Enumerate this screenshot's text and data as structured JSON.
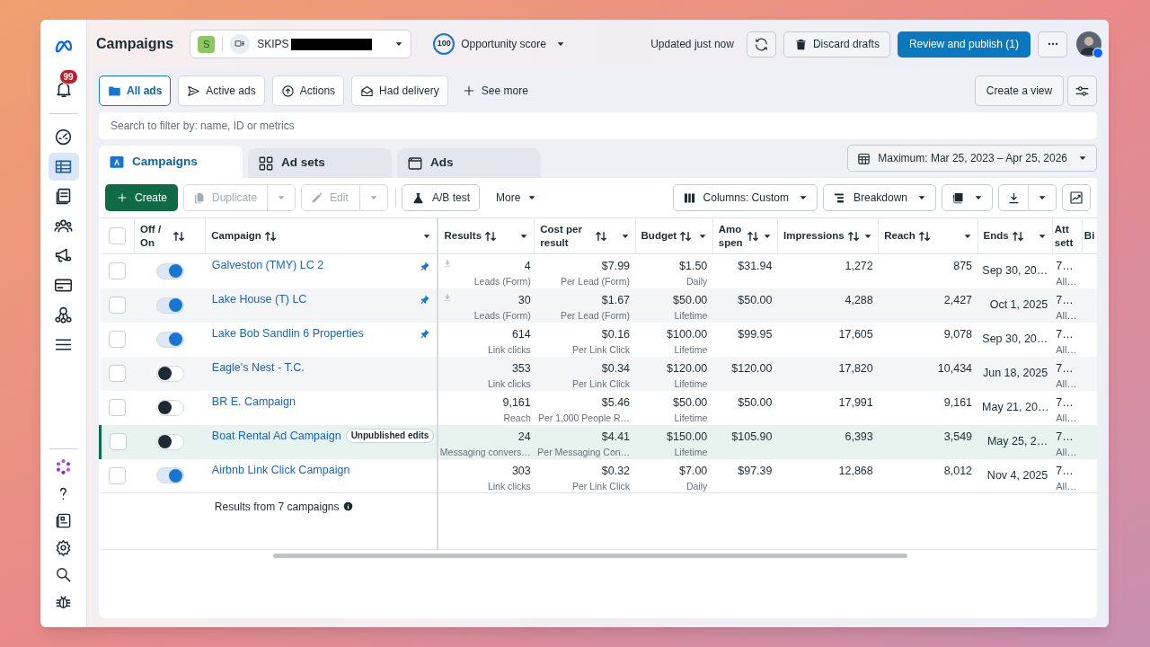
{
  "window": {
    "title": "Campaigns"
  },
  "account": {
    "initial": "S",
    "name": "SKIPS",
    "redacted": true
  },
  "opportunity": {
    "score": "100",
    "label": "Opportunity score"
  },
  "status": "Updated just now",
  "header_buttons": [
    {
      "kind": "refresh"
    },
    {
      "kind": "discard",
      "label": "Discard drafts"
    },
    {
      "kind": "publish",
      "label": "Review and publish (1)"
    },
    {
      "kind": "more"
    }
  ],
  "sidebar": {
    "notifications": "99",
    "top_items": [
      {
        "kind": "gauge",
        "selected": false
      },
      {
        "kind": "table",
        "selected": true
      },
      {
        "kind": "pages",
        "selected": false
      },
      {
        "kind": "people",
        "selected": false
      },
      {
        "kind": "megaphone",
        "selected": false
      },
      {
        "kind": "card",
        "selected": false
      },
      {
        "kind": "network",
        "selected": false
      },
      {
        "kind": "menu",
        "selected": false
      }
    ],
    "bottom_items": [
      {
        "kind": "flower"
      },
      {
        "kind": "help"
      },
      {
        "kind": "news"
      },
      {
        "kind": "settings"
      },
      {
        "kind": "search"
      },
      {
        "kind": "bug"
      }
    ]
  },
  "filters": [
    {
      "kind": "folder",
      "label": "All ads",
      "selected": true
    },
    {
      "kind": "send",
      "label": "Active ads",
      "selected": false
    },
    {
      "kind": "upload",
      "label": "Actions",
      "selected": false
    },
    {
      "kind": "mail",
      "label": "Had delivery",
      "selected": false
    },
    {
      "kind": "add",
      "label": "See more",
      "selected": false
    }
  ],
  "create_view": "Create a view",
  "search": {
    "placeholder": "Search to filter by: name, ID or metrics"
  },
  "level_tabs": [
    {
      "kind": "campaigns",
      "label": "Campaigns",
      "selected": true
    },
    {
      "kind": "adsets",
      "label": "Ad sets",
      "selected": false
    },
    {
      "kind": "ads",
      "label": "Ads",
      "selected": false
    }
  ],
  "date_range": "Maximum: Mar 25, 2023 – Apr 25, 2026",
  "toolbar": {
    "left": [
      {
        "kind": "create",
        "label": "Create",
        "disabled": false
      },
      {
        "kind": "duplicate",
        "label": "Duplicate",
        "disabled": true
      },
      {
        "kind": "edit",
        "label": "Edit",
        "disabled": true
      },
      {
        "kind": "abtest",
        "label": "A/B test",
        "disabled": false
      },
      {
        "kind": "more",
        "label": "More",
        "disabled": false
      }
    ],
    "right": [
      {
        "kind": "columns",
        "label": "Columns: Custom"
      },
      {
        "kind": "breakdown",
        "label": "Breakdown"
      },
      {
        "kind": "reports"
      },
      {
        "kind": "export"
      },
      {
        "kind": "chart"
      }
    ]
  },
  "table": {
    "columns": [
      {
        "kind": "select",
        "checked": false
      },
      {
        "label": "Off /\nOn",
        "sortable": true,
        "menu": false
      },
      {
        "label": "Campaign",
        "sortable": true,
        "menu": true
      },
      {
        "label": "Results",
        "sortable": true,
        "menu": true
      },
      {
        "label": "Cost per\nresult",
        "sortable": true,
        "menu": true
      },
      {
        "label": "Budget",
        "sortable": true,
        "menu": true
      },
      {
        "label": "Amo\nspen",
        "sortable": true,
        "menu": true
      },
      {
        "label": "Impressions",
        "sortable": true,
        "menu": true
      },
      {
        "label": "Reach",
        "sortable": true,
        "menu": true
      },
      {
        "label": "Ends",
        "sortable": true,
        "menu": true
      },
      {
        "label": "Att\nsett",
        "sortable": false,
        "menu": false
      },
      {
        "label": "Bi",
        "sortable": false,
        "menu": false
      }
    ],
    "rows": [
      {
        "checked": false,
        "on": true,
        "name": "Galveston (TMY) LC 2",
        "pinned": true,
        "lead_icon": true,
        "highlighted": false,
        "results": "4",
        "results_type": "Leads (Form)",
        "cost": "$7.99",
        "cost_type": "Per Lead (Form)",
        "budget": "$1.50",
        "budget_type": "Daily",
        "spent": "$31.94",
        "impressions": "1,272",
        "reach": "875",
        "ends": "Sep 30, 20…",
        "attribution": "7…",
        "attribution_type": "All…"
      },
      {
        "checked": false,
        "on": true,
        "name": "Lake House (T) LC",
        "pinned": true,
        "lead_icon": true,
        "highlighted": false,
        "results": "30",
        "results_type": "Leads (Form)",
        "cost": "$1.67",
        "cost_type": "Per Lead (Form)",
        "budget": "$50.00",
        "budget_type": "Lifetime",
        "spent": "$50.00",
        "impressions": "4,288",
        "reach": "2,427",
        "ends": "Oct 1, 2025",
        "attribution": "7…",
        "attribution_type": "All…"
      },
      {
        "checked": false,
        "on": true,
        "name": "Lake Bob Sandlin 6 Properties",
        "pinned": true,
        "lead_icon": false,
        "highlighted": false,
        "results": "614",
        "results_type": "Link clicks",
        "cost": "$0.16",
        "cost_type": "Per Link Click",
        "budget": "$100.00",
        "budget_type": "Lifetime",
        "spent": "$99.95",
        "impressions": "17,605",
        "reach": "9,078",
        "ends": "Sep 30, 20…",
        "attribution": "7…",
        "attribution_type": "All…"
      },
      {
        "checked": false,
        "on": false,
        "name": "Eagle's Nest - T.C.",
        "pinned": false,
        "lead_icon": false,
        "highlighted": false,
        "results": "353",
        "results_type": "Link clicks",
        "cost": "$0.34",
        "cost_type": "Per Link Click",
        "budget": "$120.00",
        "budget_type": "Lifetime",
        "spent": "$120.00",
        "impressions": "17,820",
        "reach": "10,434",
        "ends": "Jun 18, 2025",
        "attribution": "7…",
        "attribution_type": "All…"
      },
      {
        "checked": false,
        "on": false,
        "name": "BR E. Campaign",
        "pinned": false,
        "lead_icon": false,
        "highlighted": false,
        "results": "9,161",
        "results_type": "Reach",
        "cost": "$5.46",
        "cost_type": "Per 1,000 People R…",
        "budget": "$50.00",
        "budget_type": "Lifetime",
        "spent": "$50.00",
        "impressions": "17,991",
        "reach": "9,161",
        "ends": "May 21, 20…",
        "attribution": "7…",
        "attribution_type": "All…"
      },
      {
        "checked": false,
        "on": false,
        "name": "Boat Rental Ad Campaign",
        "badge": "Unpublished edits",
        "pinned": false,
        "lead_icon": false,
        "highlighted": true,
        "results": "24",
        "results_type": "Messaging convers…",
        "cost": "$4.41",
        "cost_type": "Per Messaging Con…",
        "budget": "$150.00",
        "budget_type": "Lifetime",
        "spent": "$105.90",
        "impressions": "6,393",
        "reach": "3,549",
        "ends": "May 25, 2…",
        "attribution": "7…",
        "attribution_type": "All…"
      },
      {
        "checked": false,
        "on": true,
        "name": "Airbnb Link Click Campaign",
        "pinned": false,
        "lead_icon": false,
        "highlighted": false,
        "results": "303",
        "results_type": "Link clicks",
        "cost": "$0.32",
        "cost_type": "Per Link Click",
        "budget": "$7.00",
        "budget_type": "Daily",
        "spent": "$97.39",
        "impressions": "12,868",
        "reach": "8,012",
        "ends": "Nov 4, 2025",
        "attribution": "7…",
        "attribution_type": "All…"
      }
    ],
    "footer": "Results from 7 campaigns"
  }
}
